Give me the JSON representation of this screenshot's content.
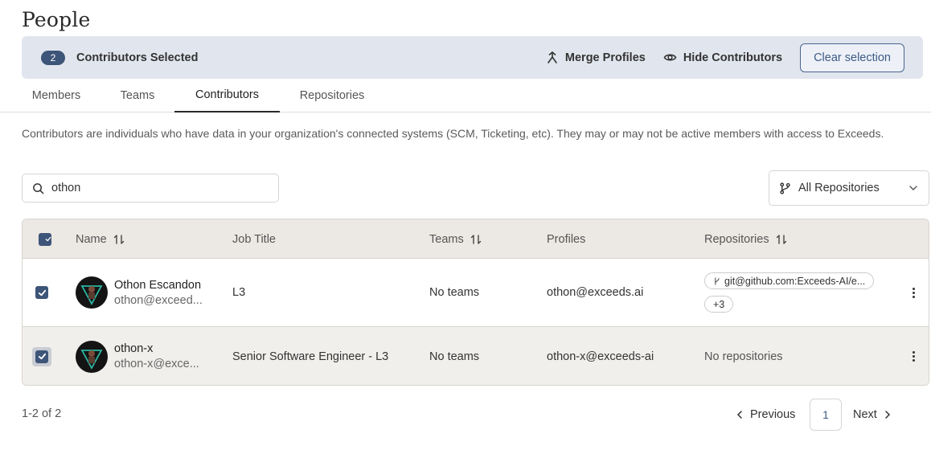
{
  "page": {
    "title": "People"
  },
  "selection": {
    "count": "2",
    "label": "Contributors Selected",
    "merge_label": "Merge Profiles",
    "hide_label": "Hide Contributors",
    "clear_label": "Clear selection"
  },
  "tabs": [
    {
      "label": "Members",
      "active": false
    },
    {
      "label": "Teams",
      "active": false
    },
    {
      "label": "Contributors",
      "active": true
    },
    {
      "label": "Repositories",
      "active": false
    }
  ],
  "description": "Contributors are individuals who have data in your organization's connected systems (SCM, Ticketing, etc). They may or may not be active members with access to Exceeds.",
  "search": {
    "value": "othon",
    "placeholder": ""
  },
  "repo_filter": {
    "label": "All Repositories"
  },
  "table": {
    "headers": {
      "name": "Name",
      "job_title": "Job Title",
      "teams": "Teams",
      "profiles": "Profiles",
      "repositories": "Repositories"
    },
    "rows": [
      {
        "selected": true,
        "name": "Othon Escandon",
        "email": "othon@exceed...",
        "job_title": "L3",
        "teams": "No teams",
        "profiles": "othon@exceeds.ai",
        "repo_chip": "git@github.com:Exceeds-AI/e...",
        "repo_more": "+3"
      },
      {
        "selected": true,
        "name": "othon-x",
        "email": "othon-x@exce...",
        "job_title": "Senior Software Engineer - L3",
        "teams": "No teams",
        "profiles": "othon-x@exceeds-ai",
        "repositories": "No repositories"
      }
    ]
  },
  "pagination": {
    "range": "1-2 of 2",
    "previous": "Previous",
    "page": "1",
    "next": "Next"
  },
  "colors": {
    "accent": "#3d5578",
    "selection_bar": "#e1e6ee",
    "header_bg": "#ece8e3"
  }
}
